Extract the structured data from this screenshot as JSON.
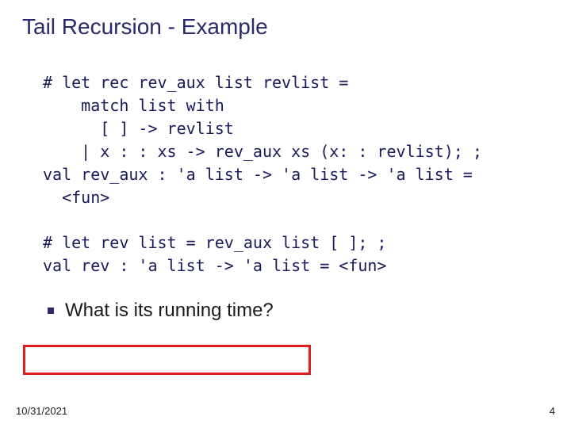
{
  "slide": {
    "title": "Tail Recursion - Example",
    "code1": "# let rec rev_aux list revlist =\n    match list with\n      [ ] -> revlist\n    | x : : xs -> rev_aux xs (x: : revlist); ;\nval rev_aux : 'a list -> 'a list -> 'a list =\n  <fun>",
    "code2": "# let rev list = rev_aux list [ ]; ;\nval rev : 'a list -> 'a list = <fun>",
    "question": "What is its running time?"
  },
  "footer": {
    "date": "10/31/2021",
    "page": "4"
  }
}
